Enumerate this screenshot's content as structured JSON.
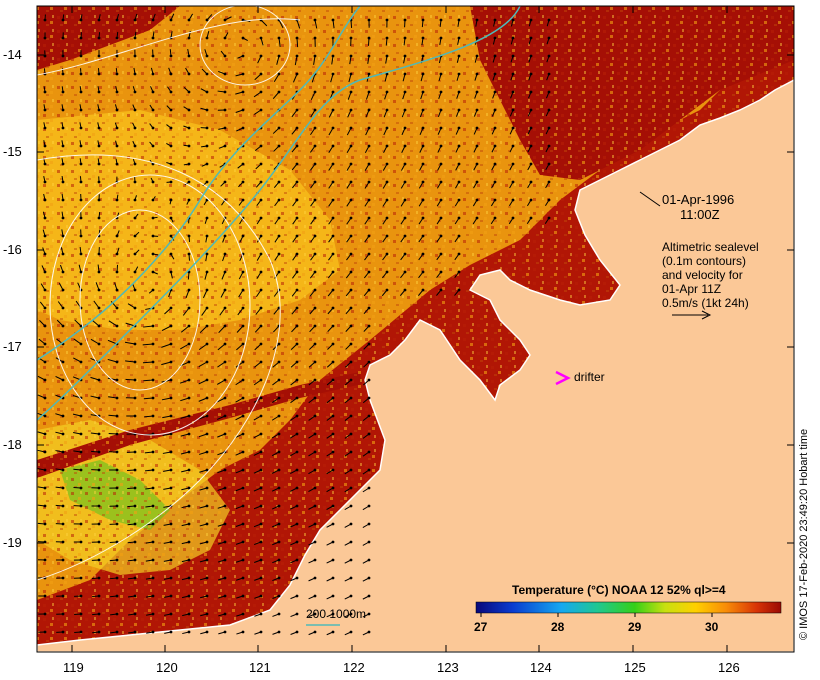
{
  "map": {
    "date_line": "01-Apr-1996",
    "time_line": "11:00Z",
    "x_ticks": [
      "119",
      "120",
      "121",
      "122",
      "123",
      "124",
      "125",
      "126"
    ],
    "y_ticks": [
      "-14",
      "-15",
      "-16",
      "-17",
      "-18",
      "-19"
    ],
    "legend_lines": [
      "Altimetric sealevel",
      "(0.1m contours)",
      "and velocity for",
      "01-Apr 11Z",
      "0.5m/s (1kt 24h)"
    ],
    "drifter_label": "drifter",
    "depth_scale_label": "200  1000m",
    "colorbar": {
      "title": "Temperature (°C) NOAA 12 52% ql>=4",
      "ticks": [
        "27",
        "28",
        "29",
        "30"
      ]
    },
    "credit": "© IMOS 17-Feb-2020 23:49:20 Hobart time"
  },
  "colors": {
    "land": "#fbc897",
    "warm": "#a50f05",
    "drifter": "#ff00ff",
    "isobath": "#4fb9b9"
  }
}
